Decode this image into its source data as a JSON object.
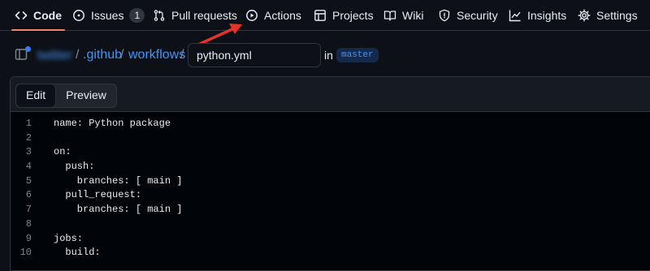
{
  "nav": {
    "items": [
      {
        "label": "Code",
        "icon": "code-icon",
        "active": true
      },
      {
        "label": "Issues",
        "icon": "issue-icon",
        "count": "1"
      },
      {
        "label": "Pull requests",
        "icon": "pull-request-icon"
      },
      {
        "label": "Actions",
        "icon": "play-circle-icon"
      },
      {
        "label": "Projects",
        "icon": "table-icon"
      },
      {
        "label": "Wiki",
        "icon": "book-icon"
      },
      {
        "label": "Security",
        "icon": "shield-icon"
      },
      {
        "label": "Insights",
        "icon": "graph-icon"
      },
      {
        "label": "Settings",
        "icon": "gear-icon"
      }
    ]
  },
  "annotation": {
    "color": "#e5322b"
  },
  "path": {
    "owner": "twitter",
    "sep": "/",
    "folder1": ".github",
    "folder2": "workflows",
    "filename": "python.yml",
    "in_label": "in",
    "branch": "master"
  },
  "editor": {
    "tabs": {
      "edit": "Edit",
      "preview": "Preview"
    },
    "lines": [
      {
        "n": "1",
        "text": "name: Python package"
      },
      {
        "n": "2",
        "text": ""
      },
      {
        "n": "3",
        "text": "on:"
      },
      {
        "n": "4",
        "text": "  push:"
      },
      {
        "n": "5",
        "text": "    branches: [ main ]"
      },
      {
        "n": "6",
        "text": "  pull_request:"
      },
      {
        "n": "7",
        "text": "    branches: [ main ]"
      },
      {
        "n": "8",
        "text": ""
      },
      {
        "n": "9",
        "text": "jobs:"
      },
      {
        "n": "10",
        "text": "  build:"
      }
    ]
  }
}
